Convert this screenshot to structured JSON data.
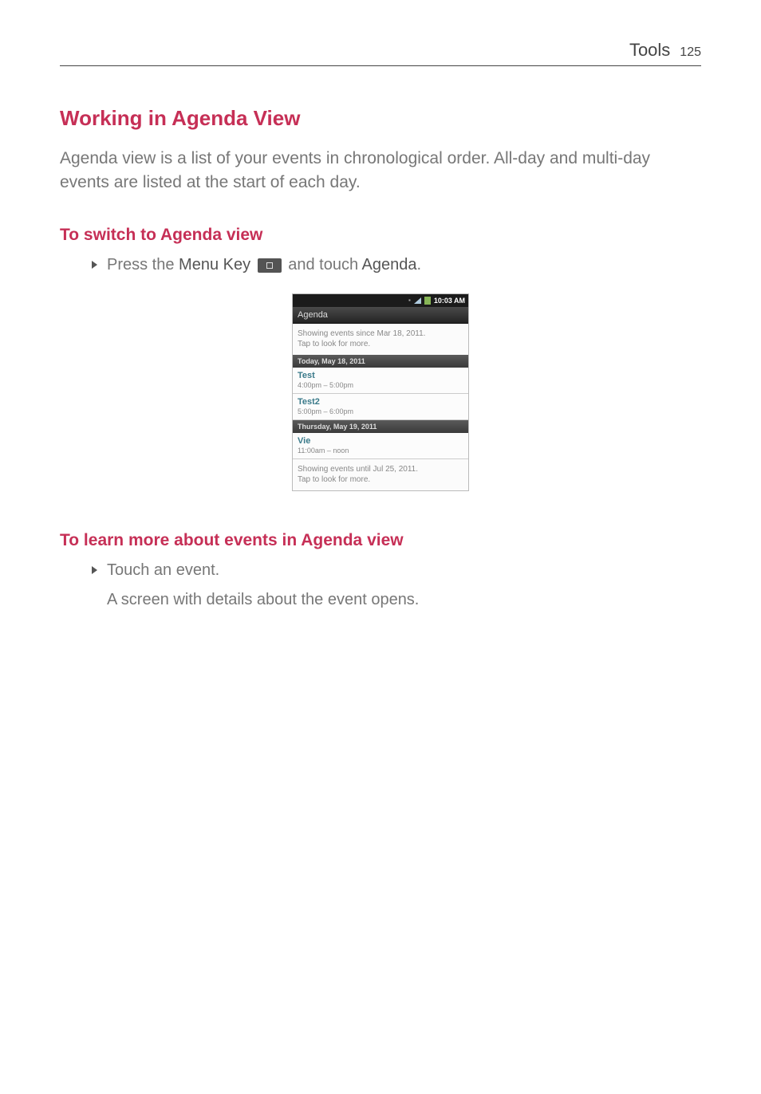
{
  "header": {
    "category": "Tools",
    "page": "125"
  },
  "section": {
    "title": "Working in Agenda View",
    "intro": "Agenda view is a list of your events in chronological order. All-day and multi-day events are listed at the start of each day."
  },
  "sub1": {
    "title": "To switch to Agenda view",
    "bullet_pre": "Press the ",
    "bullet_key1": "Menu Key",
    "bullet_mid": " and touch ",
    "bullet_key2": "Agenda",
    "bullet_post": "."
  },
  "phone": {
    "time": "10:03 AM",
    "bar_label": "Agenda",
    "top_msg1": "Showing events since Mar 18, 2011.",
    "top_msg2": "Tap to look for more.",
    "day1": "Today, May 18, 2011",
    "ev1_title": "Test",
    "ev1_time": "4:00pm – 5:00pm",
    "ev2_title": "Test2",
    "ev2_time": "5:00pm – 6:00pm",
    "day2": "Thursday, May 19, 2011",
    "ev3_title": "Vie",
    "ev3_time": "11:00am – noon",
    "bot_msg1": "Showing events until Jul 25, 2011.",
    "bot_msg2": "Tap to look for more."
  },
  "sub2": {
    "title": "To learn more about events in Agenda view",
    "bullet": "Touch an event.",
    "detail": "A screen with details about the event opens."
  }
}
